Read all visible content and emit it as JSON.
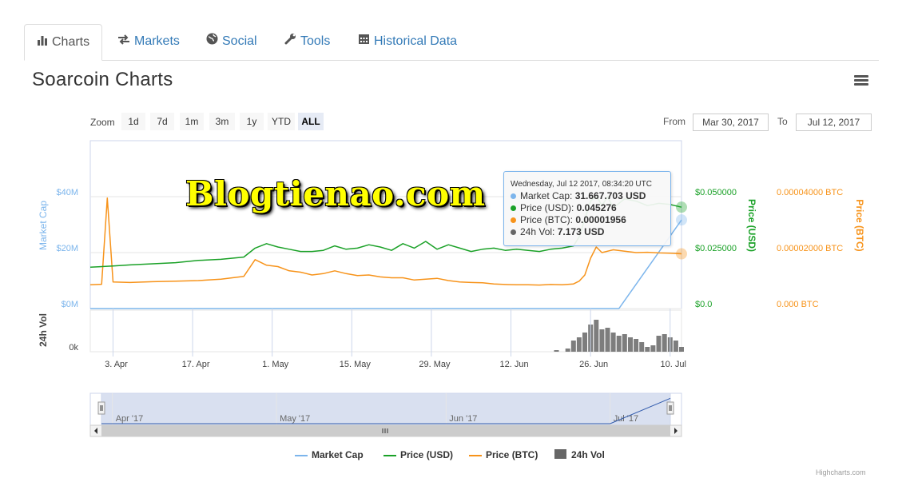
{
  "tabs": [
    {
      "label": "Charts",
      "icon": "bar-chart-icon",
      "active": true
    },
    {
      "label": "Markets",
      "icon": "exchange-icon",
      "active": false
    },
    {
      "label": "Social",
      "icon": "globe-icon",
      "active": false
    },
    {
      "label": "Tools",
      "icon": "wrench-icon",
      "active": false
    },
    {
      "label": "Historical Data",
      "icon": "calendar-icon",
      "active": false
    }
  ],
  "page_title": "Soarcoin Charts",
  "zoom": {
    "label": "Zoom",
    "buttons": [
      "1d",
      "7d",
      "1m",
      "3m",
      "1y",
      "YTD",
      "ALL"
    ],
    "selected": "ALL"
  },
  "range": {
    "from_label": "From",
    "from": "Mar 30, 2017",
    "to_label": "To",
    "to": "Jul 12, 2017"
  },
  "watermark": "Blogtienao.com",
  "tooltip": {
    "header": "Wednesday, Jul 12 2017, 08:34:20 UTC",
    "rows": [
      {
        "label": "Market Cap: ",
        "value": "31.667.703 USD",
        "color": "#7cb5ec"
      },
      {
        "label": "Price (USD): ",
        "value": "0.045276",
        "color": "#1aa127"
      },
      {
        "label": "Price (BTC): ",
        "value": "0.00001956",
        "color": "#f7931a"
      },
      {
        "label": "24h Vol: ",
        "value": "7.173 USD",
        "color": "#666666"
      }
    ]
  },
  "credits": "Highcharts.com",
  "colors": {
    "market_cap": "#7cb5ec",
    "price_usd": "#1aa127",
    "price_btc": "#f7931a",
    "volume": "#666666"
  },
  "chart_data": {
    "type": "line",
    "title": "Soarcoin Charts",
    "x_range": [
      "2017-03-30",
      "2017-07-12"
    ],
    "x_ticks": [
      "3. Apr",
      "17. Apr",
      "1. May",
      "15. May",
      "29. May",
      "12. Jun",
      "26. Jun",
      "10. Jul"
    ],
    "navigator_ticks": [
      "Apr '17",
      "May '17",
      "Jun '17",
      "Jul '17"
    ],
    "axes": {
      "market_cap": {
        "label": "Market Cap",
        "ticks": [
          "$0M",
          "$20M",
          "$40M"
        ],
        "range": [
          0,
          40
        ]
      },
      "price_usd": {
        "label": "Price (USD)",
        "ticks": [
          "$0.0",
          "$0.025000",
          "$0.050000"
        ],
        "range": [
          0,
          0.05
        ]
      },
      "price_btc": {
        "label": "Price (BTC)",
        "ticks": [
          "0.000 BTC",
          "0.00002000 BTC",
          "0.00004000 BTC"
        ],
        "range": [
          0,
          4e-05
        ]
      },
      "volume": {
        "label": "24h Vol",
        "ticks": [
          "0k"
        ]
      }
    },
    "series": [
      {
        "name": "Market Cap",
        "axis": "market_cap",
        "x": [
          "2017-03-30",
          "2017-06-30",
          "2017-07-01",
          "2017-07-12"
        ],
        "values": [
          0,
          0,
          0,
          31.67
        ]
      },
      {
        "name": "Price (USD)",
        "axis": "price_usd",
        "x": [
          "2017-03-30",
          "2017-04-03",
          "2017-04-06",
          "2017-04-10",
          "2017-04-14",
          "2017-04-18",
          "2017-04-22",
          "2017-04-26",
          "2017-04-28",
          "2017-04-30",
          "2017-05-02",
          "2017-05-04",
          "2017-05-06",
          "2017-05-08",
          "2017-05-10",
          "2017-05-12",
          "2017-05-14",
          "2017-05-16",
          "2017-05-18",
          "2017-05-20",
          "2017-05-22",
          "2017-05-24",
          "2017-05-26",
          "2017-05-28",
          "2017-05-30",
          "2017-06-01",
          "2017-06-03",
          "2017-06-05",
          "2017-06-07",
          "2017-06-09",
          "2017-06-11",
          "2017-06-13",
          "2017-06-15",
          "2017-06-17",
          "2017-06-19",
          "2017-06-21",
          "2017-06-23",
          "2017-06-24",
          "2017-06-25",
          "2017-06-26",
          "2017-06-27",
          "2017-06-28",
          "2017-06-29",
          "2017-06-30",
          "2017-07-02",
          "2017-07-04",
          "2017-07-06",
          "2017-07-08",
          "2017-07-10",
          "2017-07-12"
        ],
        "values": [
          0.0185,
          0.019,
          0.0195,
          0.02,
          0.0205,
          0.0215,
          0.022,
          0.023,
          0.027,
          0.029,
          0.0275,
          0.0265,
          0.0255,
          0.0255,
          0.026,
          0.028,
          0.0265,
          0.027,
          0.0285,
          0.0275,
          0.026,
          0.029,
          0.027,
          0.03,
          0.0265,
          0.0285,
          0.027,
          0.0255,
          0.0265,
          0.027,
          0.026,
          0.0265,
          0.026,
          0.0255,
          0.0265,
          0.027,
          0.028,
          0.032,
          0.04,
          0.048,
          0.0505,
          0.046,
          0.05,
          0.045,
          0.049,
          0.048,
          0.046,
          0.047,
          0.0465,
          0.0453
        ]
      },
      {
        "name": "Price (BTC)",
        "axis": "price_btc",
        "x": [
          "2017-03-30",
          "2017-04-01",
          "2017-04-02",
          "2017-04-03",
          "2017-04-06",
          "2017-04-10",
          "2017-04-14",
          "2017-04-18",
          "2017-04-22",
          "2017-04-26",
          "2017-04-28",
          "2017-04-30",
          "2017-05-02",
          "2017-05-04",
          "2017-05-06",
          "2017-05-08",
          "2017-05-10",
          "2017-05-12",
          "2017-05-14",
          "2017-05-16",
          "2017-05-18",
          "2017-05-20",
          "2017-05-22",
          "2017-05-24",
          "2017-05-26",
          "2017-05-28",
          "2017-05-30",
          "2017-06-01",
          "2017-06-03",
          "2017-06-05",
          "2017-06-07",
          "2017-06-09",
          "2017-06-11",
          "2017-06-13",
          "2017-06-15",
          "2017-06-17",
          "2017-06-19",
          "2017-06-21",
          "2017-06-23",
          "2017-06-24",
          "2017-06-25",
          "2017-06-26",
          "2017-06-27",
          "2017-06-28",
          "2017-06-30",
          "2017-07-02",
          "2017-07-04",
          "2017-07-06",
          "2017-07-08",
          "2017-07-10",
          "2017-07-12"
        ],
        "values": [
          8.5e-06,
          8.7e-06,
          3.95e-05,
          9.5e-06,
          9.3e-06,
          9.6e-06,
          9.8e-06,
          1e-05,
          1.05e-05,
          1.15e-05,
          1.75e-05,
          1.55e-05,
          1.5e-05,
          1.35e-05,
          1.3e-05,
          1.2e-05,
          1.25e-05,
          1.35e-05,
          1.25e-05,
          1.18e-05,
          1.2e-05,
          1.13e-05,
          1.1e-05,
          1.1e-05,
          1.02e-05,
          1.05e-05,
          1.08e-05,
          1e-05,
          9.5e-06,
          9.3e-06,
          9.2e-06,
          8.8e-06,
          8.6e-06,
          8.5e-06,
          8.5e-06,
          8.4e-06,
          8.6e-06,
          8.5e-06,
          8.8e-06,
          9.8e-06,
          1.2e-05,
          1.8e-05,
          2.2e-05,
          2e-05,
          2.1e-05,
          2.05e-05,
          2e-05,
          2.01e-05,
          1.99e-05,
          1.98e-05,
          1.956e-05
        ]
      },
      {
        "name": "24h Vol",
        "axis": "volume",
        "note_values_relative": true,
        "x": [
          "2017-06-20",
          "2017-06-22",
          "2017-06-23",
          "2017-06-24",
          "2017-06-25",
          "2017-06-26",
          "2017-06-27",
          "2017-06-28",
          "2017-06-29",
          "2017-06-30",
          "2017-07-01",
          "2017-07-02",
          "2017-07-03",
          "2017-07-04",
          "2017-07-05",
          "2017-07-06",
          "2017-07-07",
          "2017-07-08",
          "2017-07-09",
          "2017-07-10",
          "2017-07-11",
          "2017-07-12"
        ],
        "values": [
          0.05,
          0.1,
          0.35,
          0.45,
          0.6,
          0.85,
          1.0,
          0.7,
          0.75,
          0.6,
          0.5,
          0.55,
          0.45,
          0.4,
          0.3,
          0.15,
          0.2,
          0.5,
          0.55,
          0.45,
          0.35,
          0.15
        ]
      }
    ],
    "legend": [
      "Market Cap",
      "Price (USD)",
      "Price (BTC)",
      "24h Vol"
    ],
    "legend_position": "bottom",
    "grid": true
  }
}
